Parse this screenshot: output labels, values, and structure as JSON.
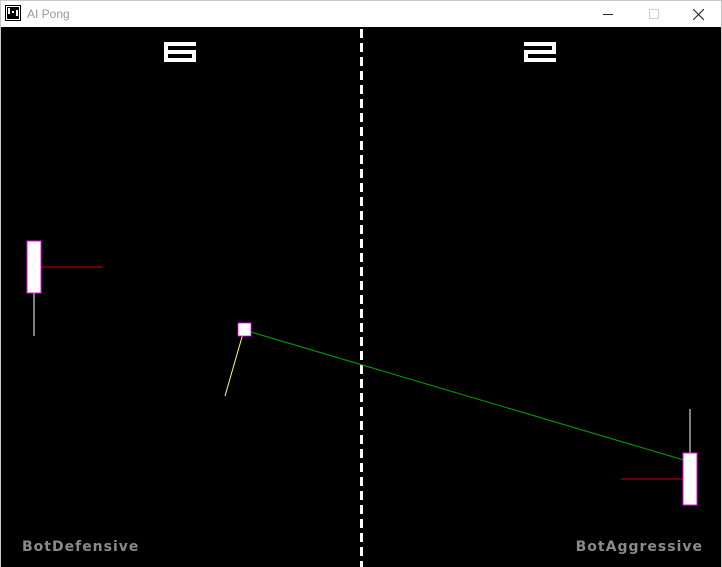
{
  "window": {
    "title": "AI Pong"
  },
  "game": {
    "score_left": 6,
    "score_right": 2,
    "player_left": "BotDefensive",
    "player_right": "BotAggressive"
  },
  "colors": {
    "background": "#000000",
    "paddle": "#ffffff",
    "paddle_outline": "#ff00ff",
    "ball": "#ffffff",
    "trajectory_line": "#00a000",
    "velocity_line": "#ffff66",
    "target_line": "#cc0000",
    "paddle_direction_line": "#ffffff",
    "net": "#ffffff",
    "player_name": "#8a8a8a"
  }
}
